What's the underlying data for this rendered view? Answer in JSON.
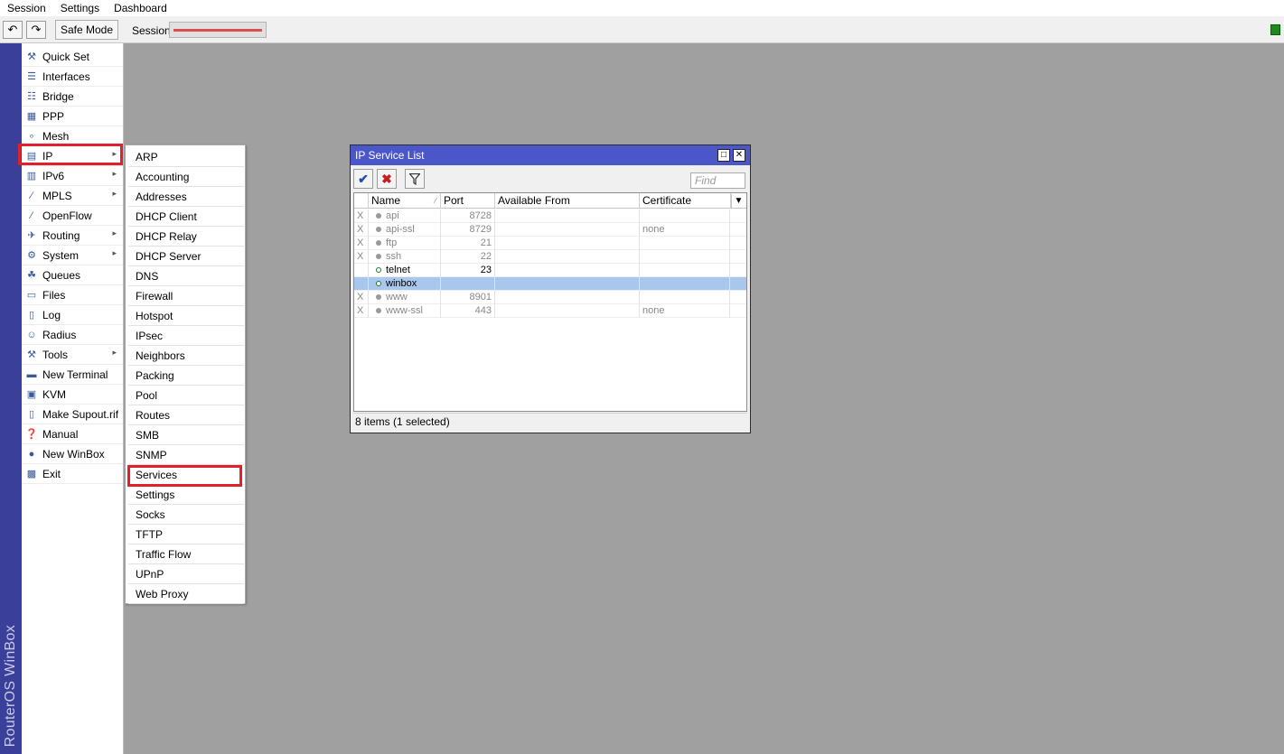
{
  "menubar": {
    "items": [
      "Session",
      "Settings",
      "Dashboard"
    ]
  },
  "toolbar": {
    "undo_icon": "undo-icon",
    "redo_icon": "redo-icon",
    "safe_mode_label": "Safe Mode",
    "session_label": "Session:",
    "session_value": "",
    "status_color": "#1e8a1e"
  },
  "brand": {
    "text": "RouterOS WinBox",
    "bar_color": "#3a3f9a"
  },
  "sidebar": {
    "items": [
      {
        "label": "Quick Set",
        "icon": "quick-set-icon",
        "submenu": false
      },
      {
        "label": "Interfaces",
        "icon": "interfaces-icon",
        "submenu": false
      },
      {
        "label": "Bridge",
        "icon": "bridge-icon",
        "submenu": false
      },
      {
        "label": "PPP",
        "icon": "ppp-icon",
        "submenu": false
      },
      {
        "label": "Mesh",
        "icon": "mesh-icon",
        "submenu": false
      },
      {
        "label": "IP",
        "icon": "ip-icon",
        "submenu": true
      },
      {
        "label": "IPv6",
        "icon": "ipv6-icon",
        "submenu": true
      },
      {
        "label": "MPLS",
        "icon": "mpls-icon",
        "submenu": true
      },
      {
        "label": "OpenFlow",
        "icon": "openflow-icon",
        "submenu": false
      },
      {
        "label": "Routing",
        "icon": "routing-icon",
        "submenu": true
      },
      {
        "label": "System",
        "icon": "system-icon",
        "submenu": true
      },
      {
        "label": "Queues",
        "icon": "queues-icon",
        "submenu": false
      },
      {
        "label": "Files",
        "icon": "files-icon",
        "submenu": false
      },
      {
        "label": "Log",
        "icon": "log-icon",
        "submenu": false
      },
      {
        "label": "Radius",
        "icon": "radius-icon",
        "submenu": false
      },
      {
        "label": "Tools",
        "icon": "tools-icon",
        "submenu": true
      },
      {
        "label": "New Terminal",
        "icon": "terminal-icon",
        "submenu": false
      },
      {
        "label": "KVM",
        "icon": "kvm-icon",
        "submenu": false
      },
      {
        "label": "Make Supout.rif",
        "icon": "supout-icon",
        "submenu": false
      },
      {
        "label": "Manual",
        "icon": "manual-icon",
        "submenu": false
      },
      {
        "label": "New WinBox",
        "icon": "winbox-icon",
        "submenu": false
      },
      {
        "label": "Exit",
        "icon": "exit-icon",
        "submenu": false
      }
    ],
    "highlight_color": "#e0202b"
  },
  "ip_submenu": {
    "items": [
      "ARP",
      "Accounting",
      "Addresses",
      "DHCP Client",
      "DHCP Relay",
      "DHCP Server",
      "DNS",
      "Firewall",
      "Hotspot",
      "IPsec",
      "Neighbors",
      "Packing",
      "Pool",
      "Routes",
      "SMB",
      "SNMP",
      "Services",
      "Settings",
      "Socks",
      "TFTP",
      "Traffic Flow",
      "UPnP",
      "Web Proxy"
    ],
    "highlighted": "Services"
  },
  "service_window": {
    "title": "IP Service List",
    "title_color": "#4b56c8",
    "find_placeholder": "Find",
    "columns": [
      "Name",
      "Port",
      "Available From",
      "Certificate"
    ],
    "rows": [
      {
        "flag": "X",
        "name": "api",
        "port": "8728",
        "available_from": "",
        "certificate": "",
        "disabled": true,
        "selected": false
      },
      {
        "flag": "X",
        "name": "api-ssl",
        "port": "8729",
        "available_from": "",
        "certificate": "none",
        "disabled": true,
        "selected": false
      },
      {
        "flag": "X",
        "name": "ftp",
        "port": "21",
        "available_from": "",
        "certificate": "",
        "disabled": true,
        "selected": false
      },
      {
        "flag": "X",
        "name": "ssh",
        "port": "22",
        "available_from": "",
        "certificate": "",
        "disabled": true,
        "selected": false
      },
      {
        "flag": "",
        "name": "telnet",
        "port": "23",
        "available_from": "",
        "certificate": "",
        "disabled": false,
        "selected": false
      },
      {
        "flag": "",
        "name": "winbox",
        "port": "",
        "available_from": "",
        "certificate": "",
        "disabled": false,
        "selected": true
      },
      {
        "flag": "X",
        "name": "www",
        "port": "8901",
        "available_from": "",
        "certificate": "",
        "disabled": true,
        "selected": false
      },
      {
        "flag": "X",
        "name": "www-ssl",
        "port": "443",
        "available_from": "",
        "certificate": "none",
        "disabled": true,
        "selected": false
      }
    ],
    "status_text": "8 items (1 selected)"
  }
}
